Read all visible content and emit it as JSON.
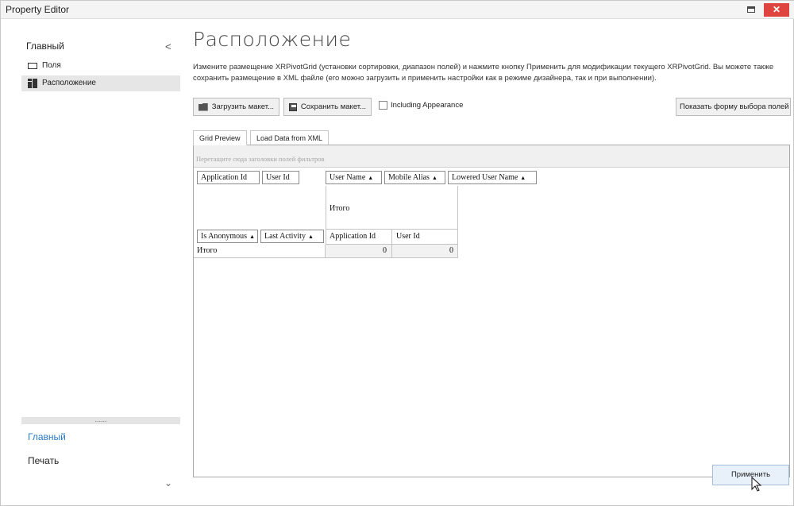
{
  "window": {
    "title": "Property Editor",
    "close_glyph": "✕"
  },
  "sidebar": {
    "header": "Главный",
    "collapse_glyph": "<",
    "items": [
      {
        "label": "Поля",
        "icon": "field-icon"
      },
      {
        "label": "Расположение",
        "icon": "layout-icon",
        "active": true
      }
    ],
    "divider_glyph": "......",
    "nav": [
      {
        "label": "Главный",
        "active": true
      },
      {
        "label": "Печать"
      }
    ],
    "expand_glyph": "⌄"
  },
  "content": {
    "title": "Расположение",
    "description": "Измените размещение XRPivotGrid (установки сортировки, диапазон полей) и нажмите кнопку Применить для модификации  текущего XRPivotGrid. Вы можете также сохранить размещение в XML файле (его можно загрузить и применить настройки как в режиме дизайнера, так и при выполнении).",
    "toolbar": {
      "load_label": "Загрузить макет...",
      "save_label": "Сохранить макет...",
      "including_appearance": "Including Appearance",
      "show_fields_label": "Показать форму выбора полей"
    },
    "tabs": [
      "Grid Preview",
      "Load Data from XML"
    ],
    "grid": {
      "filter_hint": "Перетащите сюда заголовки полей фильтров",
      "data_fields": [
        "Application Id",
        "User Id"
      ],
      "column_fields": [
        "User Name",
        "Mobile Alias",
        "Lowered User Name"
      ],
      "row_fields": [
        "Is Anonymous",
        "Last Activity"
      ],
      "column_total": "Итого",
      "column_value_headers": [
        "Application Id",
        "User Id"
      ],
      "row_total": "Итого",
      "values": [
        "0",
        "0"
      ],
      "sort_glyph": "▲"
    },
    "apply_label": "Применить"
  },
  "colors": {
    "accent": "#2a7ac7",
    "close": "#e0443e",
    "selection": "#e6e6e6"
  }
}
